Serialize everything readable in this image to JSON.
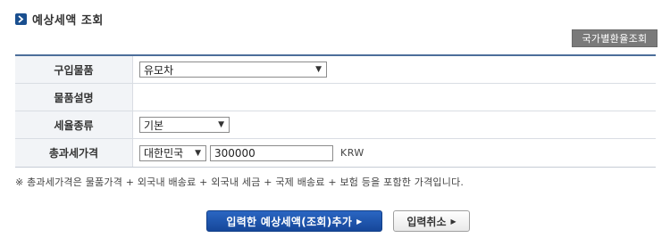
{
  "header": {
    "title": "예상세액 조회",
    "title_icon": "chevron-right-icon"
  },
  "toolbar": {
    "rate_button_label": "국가별환율조회"
  },
  "form": {
    "goods_label": "구입물품",
    "goods_value": "유모차",
    "description_label": "물품설명",
    "description_value": "",
    "tax_rate_label": "세율종류",
    "tax_rate_value": "기본",
    "total_price_label": "총과세가격",
    "country_value": "대한민국",
    "price_value": "300000",
    "currency": "KRW"
  },
  "note": "※ 총과세가격은 물품가격 + 외국내 배송료 + 외국내 세금 + 국제 배송료 + 보험 등을 포함한 가격입니다.",
  "actions": {
    "add_label": "입력한 예상세액(조회)추가",
    "cancel_label": "입력취소",
    "arrow_icon": "triangle-right-icon"
  },
  "colors": {
    "accent": "#1a4f8f",
    "primary_button": "#1d55ad",
    "table_border": "#4c6e9a",
    "gray_button": "#7a7a7a"
  }
}
